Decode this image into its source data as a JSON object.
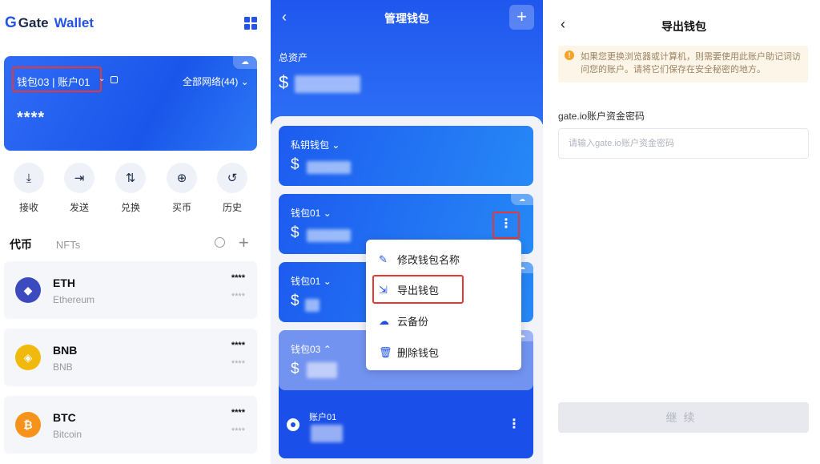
{
  "panel1": {
    "logo_text": "Gate",
    "logo_suffix": "Wallet",
    "wallet_selector": "钱包03 | 账户01",
    "network": "全部网络(44)",
    "balance_hidden": "****",
    "actions": [
      {
        "label": "接收",
        "icon": "download-icon"
      },
      {
        "label": "发送",
        "icon": "send-icon"
      },
      {
        "label": "兑换",
        "icon": "swap-icon"
      },
      {
        "label": "买币",
        "icon": "buy-icon"
      },
      {
        "label": "历史",
        "icon": "history-icon"
      }
    ],
    "tabs": [
      "代币",
      "NFTs"
    ],
    "coins": [
      {
        "symbol": "ETH",
        "name": "Ethereum",
        "v1": "****",
        "v2": "****",
        "color": "#3b4bbf"
      },
      {
        "symbol": "BNB",
        "name": "BNB",
        "v1": "****",
        "v2": "****",
        "color": "#f0b90b"
      },
      {
        "symbol": "BTC",
        "name": "Bitcoin",
        "v1": "****",
        "v2": "****",
        "color": "#f7931a"
      }
    ]
  },
  "panel2": {
    "title": "管理钱包",
    "total_label": "总资产",
    "currency": "$",
    "wallets": [
      {
        "name": "私钥钱包"
      },
      {
        "name": "钱包01"
      },
      {
        "name": "钱包01"
      },
      {
        "name": "钱包03"
      }
    ],
    "menu": [
      {
        "label": "修改钱包名称",
        "icon": "edit-icon"
      },
      {
        "label": "导出钱包",
        "icon": "export-icon"
      },
      {
        "label": "云备份",
        "icon": "cloud-icon"
      },
      {
        "label": "删除钱包",
        "icon": "delete-icon"
      }
    ],
    "account": "账户01"
  },
  "panel3": {
    "title": "导出钱包",
    "warning": "如果您更换浏览器或计算机，则需要使用此账户助记词访问您的账户。请将它们保存在安全秘密的地方。",
    "field_label": "gate.io账户资金密码",
    "field_placeholder": "请输入gate.io账户资金密码",
    "field_value": "",
    "continue": "继续"
  },
  "colors": {
    "accent": "#2354e6",
    "highlight": "#e53935",
    "warning_bg": "#fdf6e8"
  }
}
